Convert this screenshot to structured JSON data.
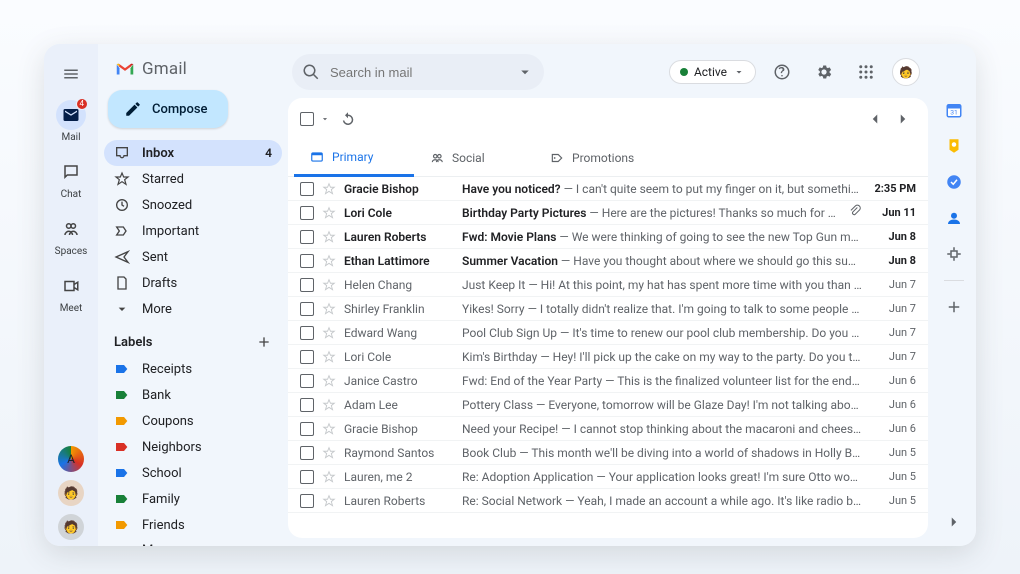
{
  "brand": "Gmail",
  "compose": "Compose",
  "search_placeholder": "Search in mail",
  "status": "Active",
  "rail": [
    {
      "name": "mail",
      "label": "Mail",
      "badge": "4"
    },
    {
      "name": "chat",
      "label": "Chat"
    },
    {
      "name": "spaces",
      "label": "Spaces"
    },
    {
      "name": "meet",
      "label": "Meet"
    }
  ],
  "nav": [
    {
      "icon": "inbox",
      "label": "Inbox",
      "count": "4",
      "active": true
    },
    {
      "icon": "star",
      "label": "Starred"
    },
    {
      "icon": "clock",
      "label": "Snoozed"
    },
    {
      "icon": "important",
      "label": "Important"
    },
    {
      "icon": "sent",
      "label": "Sent"
    },
    {
      "icon": "draft",
      "label": "Drafts"
    },
    {
      "icon": "more",
      "label": "More"
    }
  ],
  "labels_header": "Labels",
  "labels": [
    {
      "color": "#1a73e8",
      "label": "Receipts"
    },
    {
      "color": "#188038",
      "label": "Bank"
    },
    {
      "color": "#f29900",
      "label": "Coupons"
    },
    {
      "color": "#d93025",
      "label": "Neighbors"
    },
    {
      "color": "#1a73e8",
      "label": "School"
    },
    {
      "color": "#188038",
      "label": "Family"
    },
    {
      "color": "#f29900",
      "label": "Friends"
    }
  ],
  "labels_more": "More",
  "tabs": [
    {
      "name": "primary",
      "label": "Primary",
      "active": true
    },
    {
      "name": "social",
      "label": "Social"
    },
    {
      "name": "promotions",
      "label": "Promotions"
    }
  ],
  "messages": [
    {
      "sender": "Gracie Bishop",
      "subject": "Have you noticed?",
      "preview": "I can't quite seem to put my finger on it, but somethin…",
      "date": "2:35 PM",
      "unread": true
    },
    {
      "sender": "Lori Cole",
      "subject": "Birthday Party Pictures",
      "preview": "Here are the pictures! Thanks so much for helpi…",
      "date": "Jun 11",
      "unread": true,
      "attach": true
    },
    {
      "sender": "Lauren Roberts",
      "subject": "Fwd: Movie Plans",
      "preview": "We were thinking of going to see the new Top Gun mo…",
      "date": "Jun 8",
      "unread": true
    },
    {
      "sender": "Ethan Lattimore",
      "subject": "Summer Vacation",
      "preview": "Have you thought about where we should go this sum…",
      "date": "Jun 8",
      "unread": true
    },
    {
      "sender": "Helen Chang",
      "subject": "Just Keep It",
      "preview": "Hi! At this point, my hat has spent more time with you than w…",
      "date": "Jun 7"
    },
    {
      "sender": "Shirley Franklin",
      "subject": "Yikes! Sorry",
      "preview": "I totally didn't realize that. I'm going to talk to some people a…",
      "date": "Jun 7"
    },
    {
      "sender": "Edward Wang",
      "subject": "Pool Club Sign Up",
      "preview": "It's time to renew our pool club membership. Do you re…",
      "date": "Jun 7"
    },
    {
      "sender": "Lori Cole",
      "subject": "Kim's Birthday",
      "preview": "Hey! I'll pick up the cake on my way to the party. Do you th…",
      "date": "Jun 7"
    },
    {
      "sender": "Janice Castro",
      "subject": "Fwd: End of the Year Party",
      "preview": "This is the finalized volunteer list for the end of…",
      "date": "Jun 6"
    },
    {
      "sender": "Adam Lee",
      "subject": "Pottery Class",
      "preview": "Everyone, tomorrow will be Glaze Day! I'm not talking about…",
      "date": "Jun 6"
    },
    {
      "sender": "Gracie Bishop",
      "subject": "Need your Recipe!",
      "preview": "I cannot stop thinking about the macaroni and cheese…",
      "date": "Jun 6"
    },
    {
      "sender": "Raymond Santos",
      "subject": "Book Club",
      "preview": "This month we'll be diving into a world of shadows in Holly Bla…",
      "date": "Jun 5"
    },
    {
      "sender": "Lauren, me 2",
      "subject": "Re: Adoption Application",
      "preview": "Your application looks great! I'm sure Otto would…",
      "date": "Jun 5"
    },
    {
      "sender": "Lauren Roberts",
      "subject": "Re: Social Network",
      "preview": "Yeah, I made an account a while ago. It's like radio but…",
      "date": "Jun 5"
    }
  ]
}
